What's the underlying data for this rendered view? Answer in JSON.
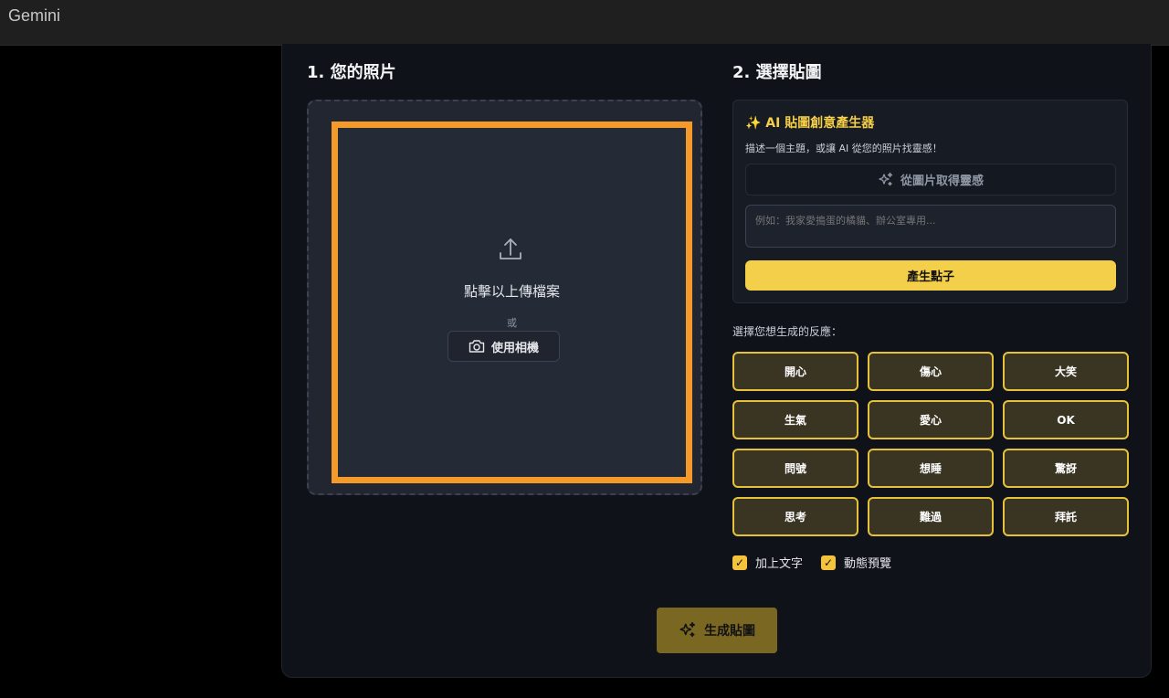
{
  "app": {
    "title": "Gemini"
  },
  "section1": {
    "title": "1. 您的照片",
    "upload_text": "點擊以上傳檔案",
    "or_text": "或",
    "camera_label": "使用相機"
  },
  "section2": {
    "title": "2. 選擇貼圖",
    "ai_box": {
      "title": "✨ AI 貼圖創意產生器",
      "description": "描述一個主題，或讓 AI 從您的照片找靈感！",
      "inspire_label": "從圖片取得靈感",
      "input_value": "",
      "input_placeholder": "例如：我家愛搗蛋的橘貓、辦公室專用...",
      "generate_label": "產生點子"
    },
    "reaction_label": "選擇您想生成的反應：",
    "reactions": [
      "開心",
      "傷心",
      "大笑",
      "生氣",
      "愛心",
      "OK",
      "問號",
      "想睡",
      "驚訝",
      "思考",
      "難過",
      "拜託"
    ],
    "options": [
      {
        "label": "加上文字",
        "checked": true
      },
      {
        "label": "動態預覽",
        "checked": true
      }
    ]
  },
  "generate_button": {
    "label": "生成貼圖"
  },
  "colors": {
    "accent_yellow": "#f4d04a",
    "frame_orange": "#f39a2b",
    "reaction_border": "#e6c23a",
    "generate_disabled": "#7a6722"
  },
  "icons": {
    "upload": "upload-icon",
    "camera": "camera-icon",
    "sparkle": "sparkle-icon",
    "check": "check-icon"
  }
}
